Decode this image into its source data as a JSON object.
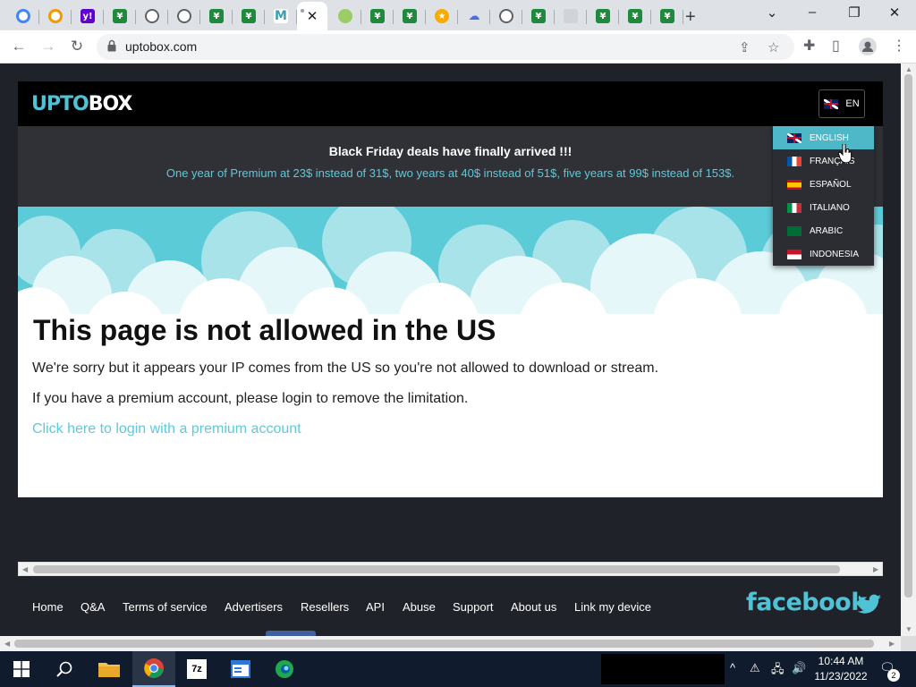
{
  "browser": {
    "tabs": [
      {
        "icon": "g-icon",
        "glyph": "G",
        "style": "g"
      },
      {
        "icon": "search-q-icon",
        "glyph": "",
        "style": "q"
      },
      {
        "icon": "yahoo-icon",
        "glyph": "y!",
        "style": "y"
      },
      {
        "icon": "uptobox-icon",
        "glyph": "¥",
        "style": "green"
      },
      {
        "icon": "globe-icon",
        "glyph": "",
        "style": "globe"
      },
      {
        "icon": "globe-icon",
        "glyph": "",
        "style": "globe"
      },
      {
        "icon": "uptobox-icon",
        "glyph": "¥",
        "style": "green"
      },
      {
        "icon": "uptobox-icon",
        "glyph": "¥",
        "style": "green"
      },
      {
        "icon": "m-icon",
        "glyph": "M",
        "style": "m"
      },
      {
        "icon": "close-icon",
        "glyph": "✕",
        "style": "active"
      },
      {
        "icon": "leaf-icon",
        "glyph": "",
        "style": "leaf"
      },
      {
        "icon": "uptobox-icon",
        "glyph": "¥",
        "style": "green"
      },
      {
        "icon": "uptobox-icon",
        "glyph": "¥",
        "style": "green"
      },
      {
        "icon": "star-icon",
        "glyph": "★",
        "style": "star"
      },
      {
        "icon": "cloud-icon",
        "glyph": "☁",
        "style": "cloud"
      },
      {
        "icon": "globe-icon",
        "glyph": "",
        "style": "globe"
      },
      {
        "icon": "uptobox-icon",
        "glyph": "¥",
        "style": "green"
      },
      {
        "icon": "gray-site-icon",
        "glyph": "",
        "style": "gray"
      },
      {
        "icon": "uptobox-icon",
        "glyph": "¥",
        "style": "green"
      },
      {
        "icon": "uptobox-icon",
        "glyph": "¥",
        "style": "green"
      },
      {
        "icon": "uptobox-icon",
        "glyph": "¥",
        "style": "green"
      }
    ],
    "url": "uptobox.com"
  },
  "site": {
    "logo_a": "UPTO",
    "logo_b": "BOX",
    "lang_current": "EN",
    "banner_title": "Black Friday deals have finally arrived !!!",
    "banner_text": "One year of Premium at 23$ instead of 31$, two years at 40$ instead of 51$, five years at 99$ instead of 153$.",
    "heading": "This page is not allowed in the US",
    "p1": "We're sorry but it appears your IP comes from the US so you're not allowed to download or stream.",
    "p2": "If you have a premium account, please login to remove the limitation.",
    "login_link": "Click here to login with a premium account",
    "languages": [
      "ENGLISH",
      "FRANÇAIS",
      "ESPAÑOL",
      "ITALIANO",
      "ARABIC",
      "INDONESIA"
    ],
    "footer_links": [
      "Home",
      "Q&A",
      "Terms of service",
      "Advertisers",
      "Resellers",
      "API",
      "Abuse",
      "Support",
      "About us",
      "Link my device"
    ],
    "facebook": "facebook"
  },
  "taskbar": {
    "time": "10:44 AM",
    "date": "11/23/2022",
    "notifications": "2"
  },
  "colors": {
    "accent": "#4fc3d5",
    "page_bg": "#20222a",
    "banner_bg": "#2f3136"
  }
}
